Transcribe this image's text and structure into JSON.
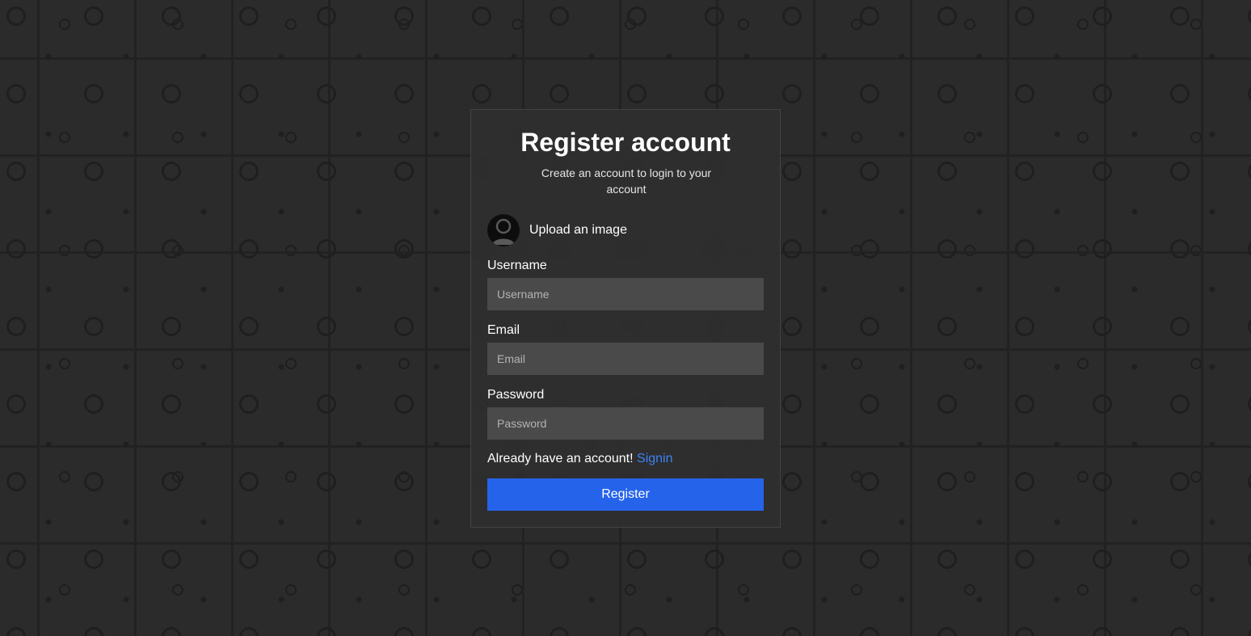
{
  "form": {
    "title": "Register account",
    "subtitle": "Create an account to login to your account",
    "upload_label": "Upload an image",
    "username_label": "Username",
    "username_placeholder": "Username",
    "email_label": "Email",
    "email_placeholder": "Email",
    "password_label": "Password",
    "password_placeholder": "Password",
    "signin_prompt": "Already have an account!",
    "signin_link": "Signin",
    "register_button": "Register"
  },
  "colors": {
    "accent": "#2563eb",
    "link": "#3b82f6",
    "background": "#2b2b2b",
    "input_bg": "#4a4a4a"
  }
}
